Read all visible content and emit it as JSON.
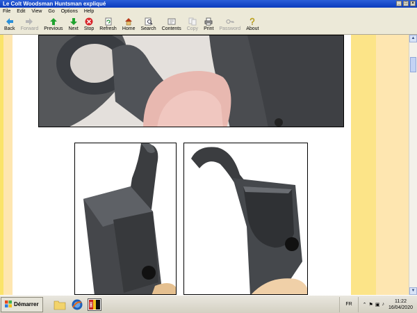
{
  "window": {
    "title": "Le Colt Woodsman Huntsman expliqué"
  },
  "menu": [
    "File",
    "Edit",
    "View",
    "Go",
    "Options",
    "Help"
  ],
  "toolbar": [
    {
      "label": "Back",
      "icon": "arrow-left-icon",
      "enabled": true
    },
    {
      "label": "Forward",
      "icon": "arrow-right-icon",
      "enabled": false
    },
    {
      "label": "Previous",
      "icon": "arrow-up-icon",
      "enabled": true
    },
    {
      "label": "Next",
      "icon": "arrow-down-icon",
      "enabled": true
    },
    {
      "label": "Stop",
      "icon": "stop-icon",
      "enabled": true
    },
    {
      "label": "Refresh",
      "icon": "refresh-icon",
      "enabled": true
    },
    {
      "label": "Home",
      "icon": "home-icon",
      "enabled": true
    },
    {
      "label": "Search",
      "icon": "search-icon",
      "enabled": true
    },
    {
      "label": "Contents",
      "icon": "contents-icon",
      "enabled": true
    },
    {
      "label": "Copy",
      "icon": "copy-icon",
      "enabled": false
    },
    {
      "label": "Print",
      "icon": "print-icon",
      "enabled": true
    },
    {
      "label": "Password",
      "icon": "key-icon",
      "enabled": false
    },
    {
      "label": "About",
      "icon": "about-icon",
      "enabled": true
    }
  ],
  "taskbar": {
    "start_label": "Démarrer",
    "language": "FR",
    "time": "11:22",
    "date": "16/04/2020"
  },
  "colors": {
    "content_bg": "#fee6b0",
    "stripe": "#fce488",
    "titlebar": "#0a3bbd"
  }
}
